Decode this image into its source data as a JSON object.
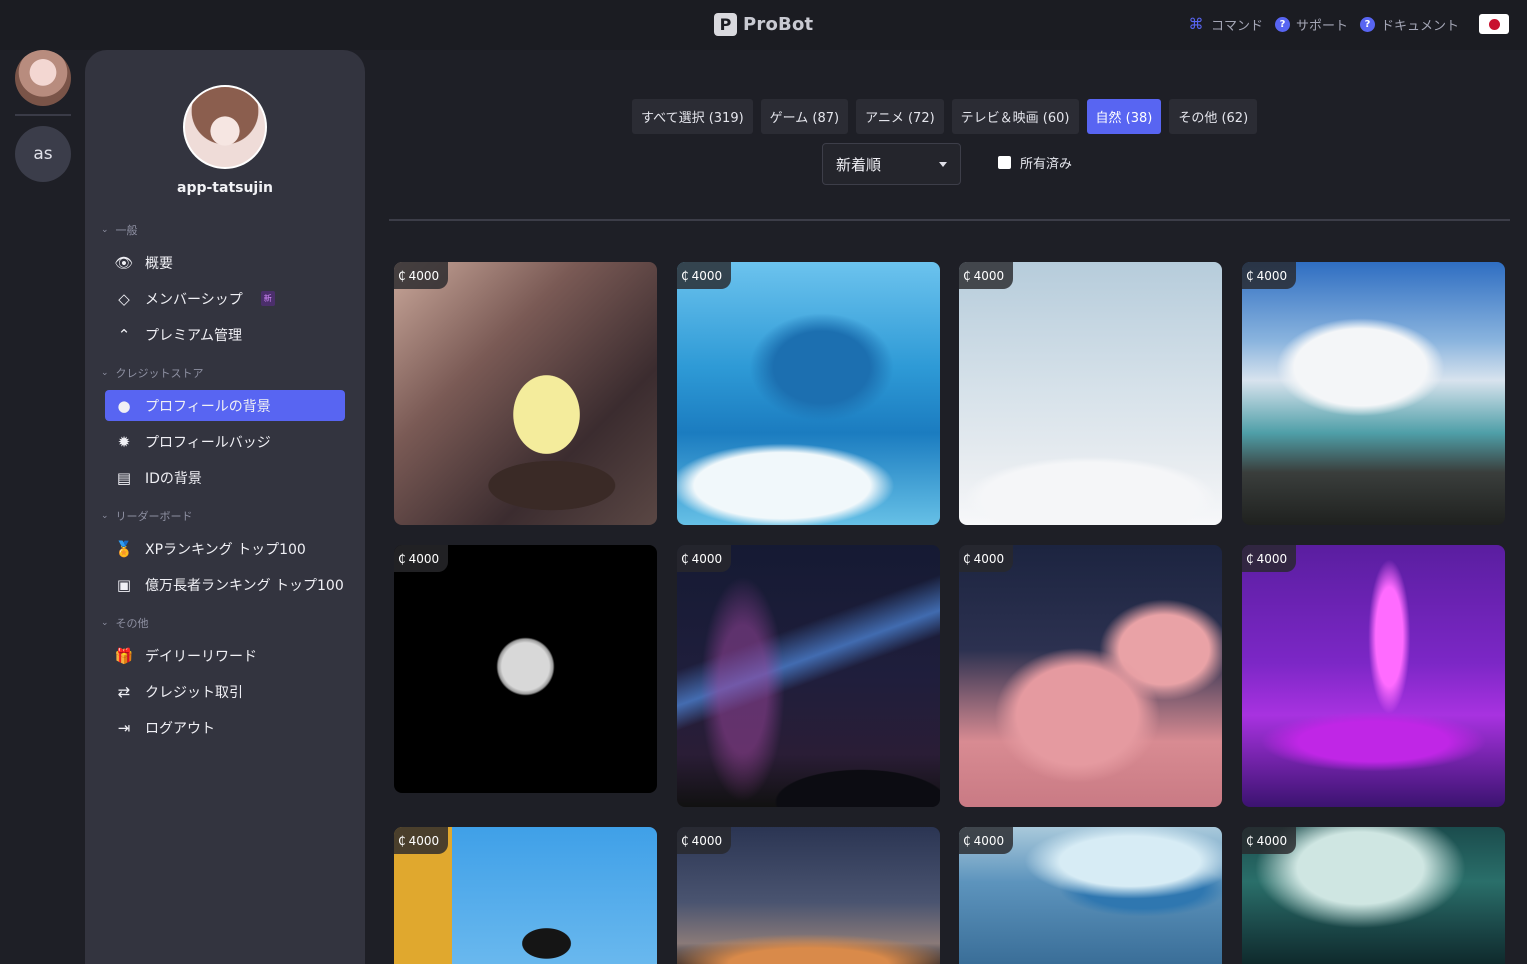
{
  "topbar": {
    "brand_letter": "P",
    "brand_name": "ProBot",
    "nav": [
      {
        "icon": "command-icon",
        "label": "コマンド"
      },
      {
        "icon": "question-icon",
        "label": "サポート"
      },
      {
        "icon": "question-icon",
        "label": "ドキュメント"
      }
    ],
    "language_flag": "japan-flag"
  },
  "rail": {
    "server_initials": "as"
  },
  "sidebar": {
    "username": "app-tatsujin",
    "sections": [
      {
        "title": "一般",
        "items": [
          {
            "icon": "eye-icon",
            "label": "概要"
          },
          {
            "icon": "diamond-icon",
            "label": "メンバーシップ",
            "badge": "新"
          },
          {
            "icon": "chevron-up-circle-icon",
            "label": "プレミアム管理"
          }
        ]
      },
      {
        "title": "クレジットストア",
        "items": [
          {
            "icon": "user-circle-icon",
            "label": "プロフィールの背景",
            "active": true
          },
          {
            "icon": "badge-icon",
            "label": "プロフィールバッジ"
          },
          {
            "icon": "id-card-icon",
            "label": "IDの背景"
          }
        ]
      },
      {
        "title": "リーダーボード",
        "items": [
          {
            "icon": "medal-icon",
            "label": "XPランキング トップ100"
          },
          {
            "icon": "money-icon",
            "label": "億万長者ランキング トップ100"
          }
        ]
      },
      {
        "title": "その他",
        "items": [
          {
            "icon": "gift-icon",
            "label": "デイリーリワード"
          },
          {
            "icon": "transfer-icon",
            "label": "クレジット取引"
          },
          {
            "icon": "logout-icon",
            "label": "ログアウト"
          }
        ]
      }
    ]
  },
  "filters": [
    {
      "label": "すべて選択 (319)"
    },
    {
      "label": "ゲーム (87)"
    },
    {
      "label": "アニメ (72)"
    },
    {
      "label": "テレビ＆映画 (60)"
    },
    {
      "label": "自然 (38)",
      "active": true
    },
    {
      "label": "その他 (62)"
    }
  ],
  "sort": {
    "selected": "新着順"
  },
  "owned_filter": {
    "label": "所有済み",
    "checked": false
  },
  "currency_symbol": "₵",
  "cards": [
    {
      "price": "4000",
      "image": "duckling"
    },
    {
      "price": "4000",
      "image": "ocean-wave"
    },
    {
      "price": "4000",
      "image": "sea-of-clouds"
    },
    {
      "price": "4000",
      "image": "waterfall"
    },
    {
      "price": "4000",
      "image": "full-moon"
    },
    {
      "price": "4000",
      "image": "starry-sky"
    },
    {
      "price": "4000",
      "image": "pink-clouds"
    },
    {
      "price": "4000",
      "image": "purple-forest-deer"
    },
    {
      "price": "4000",
      "image": "bird"
    },
    {
      "price": "4000",
      "image": "dusk-sky"
    },
    {
      "price": "4000",
      "image": "iceberg"
    },
    {
      "price": "4000",
      "image": "ship-iceberg"
    }
  ]
}
